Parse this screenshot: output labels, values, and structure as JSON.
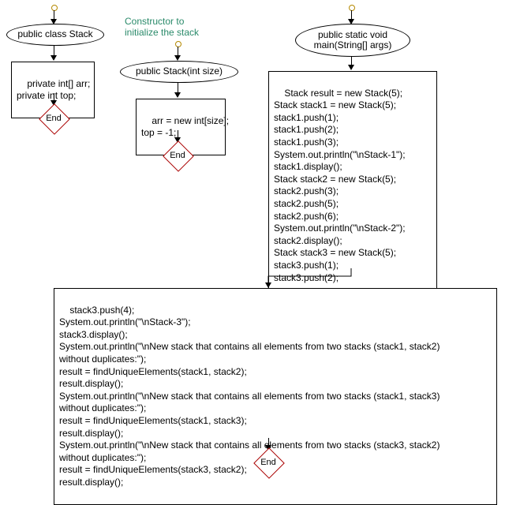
{
  "flow1": {
    "ellipse": "public class Stack",
    "rect": "private int[] arr;\nprivate int top;",
    "end": "End"
  },
  "flow2": {
    "annotation": "Constructor to\ninitialize the stack",
    "ellipse": "public Stack(int size)",
    "rect": "arr = new int[size];\ntop = -1;",
    "end": "End"
  },
  "flow3": {
    "ellipse": "public static void\nmain(String[] args)",
    "rect1": "Stack result = new Stack(5);\nStack stack1 = new Stack(5);\nstack1.push(1);\nstack1.push(2);\nstack1.push(3);\nSystem.out.println(\"\\nStack-1\");\nstack1.display();\nStack stack2 = new Stack(5);\nstack2.push(3);\nstack2.push(5);\nstack2.push(6);\nSystem.out.println(\"\\nStack-2\");\nstack2.display();\nStack stack3 = new Stack(5);\nstack3.push(1);\nstack3.push(2);",
    "rect2": "stack3.push(4);\nSystem.out.println(\"\\nStack-3\");\nstack3.display();\nSystem.out.println(\"\\nNew stack that contains all elements from two stacks (stack1, stack2)\nwithout duplicates:\");\nresult = findUniqueElements(stack1, stack2);\nresult.display();\nSystem.out.println(\"\\nNew stack that contains all elements from two stacks (stack1, stack3)\nwithout duplicates:\");\nresult = findUniqueElements(stack1, stack3);\nresult.display();\nSystem.out.println(\"\\nNew stack that contains all elements from two stacks (stack3, stack2)\nwithout duplicates:\");\nresult = findUniqueElements(stack3, stack2);\nresult.display();",
    "end": "End"
  }
}
